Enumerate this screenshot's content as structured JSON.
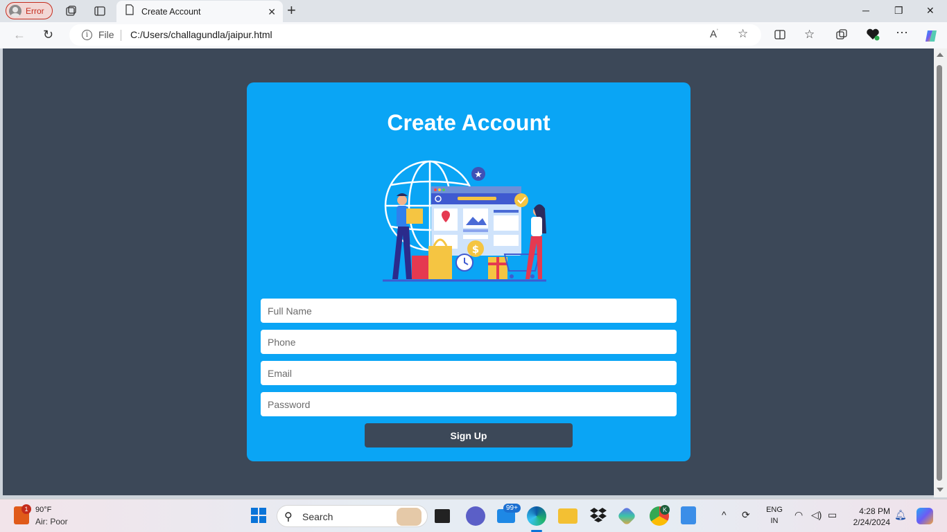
{
  "browser": {
    "profile_label": "Error",
    "tab_title": "Create Account",
    "address_prefix": "File",
    "url": "C:/Users/challagundla/jaipur.html"
  },
  "page": {
    "title": "Create Account",
    "fields": {
      "full_name_placeholder": "Full Name",
      "phone_placeholder": "Phone",
      "email_placeholder": "Email",
      "password_placeholder": "Password"
    },
    "signup_label": "Sign Up",
    "colors": {
      "background": "#3c4858",
      "card": "#0aa5f5",
      "button": "#3c4858",
      "title": "#ffffff"
    }
  },
  "taskbar": {
    "weather_temp": "90°F",
    "weather_status": "Air: Poor",
    "weather_badge": "1",
    "search_label": "Search",
    "mail_badge": "99+",
    "chrome_badge": "K",
    "language": "ENG",
    "region": "IN",
    "time": "4:28 PM",
    "date": "2/24/2024"
  },
  "icons": [
    "profile-icon",
    "collections-icon",
    "tab-actions-icon",
    "page-icon",
    "close-icon",
    "plus-icon",
    "minimize-icon",
    "restore-icon",
    "back-icon",
    "refresh-icon",
    "info-icon",
    "read-aloud-icon",
    "favorite-icon",
    "split-screen-icon",
    "favorites-icon",
    "collections-icon",
    "browser-essentials-icon",
    "more-icon",
    "copilot-icon",
    "windows-icon",
    "search-icon",
    "notification-icon"
  ]
}
